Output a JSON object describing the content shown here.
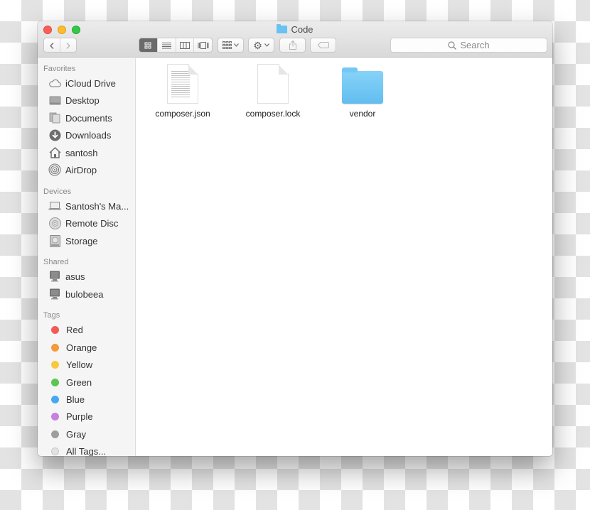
{
  "window": {
    "title": "Code",
    "title_icon": "folder-icon"
  },
  "toolbar": {
    "back_icon": "‹",
    "forward_icon": "›",
    "view_modes": [
      {
        "name": "icon-view",
        "glyph": "▦",
        "active": true
      },
      {
        "name": "list-view",
        "glyph": "≡",
        "active": false
      },
      {
        "name": "column-view",
        "glyph": "▥",
        "active": false
      },
      {
        "name": "cover-flow-view",
        "glyph": "◫",
        "active": false
      }
    ],
    "arrange_glyph": "▦",
    "action_glyph": "⚙",
    "chevron": "⌄",
    "share_glyph": "⇧",
    "tag_glyph": "⬭",
    "search_placeholder": "Search",
    "search_icon": "🔍"
  },
  "sidebar": {
    "sections": [
      {
        "title": "Favorites",
        "items": [
          {
            "label": "iCloud Drive",
            "icon": "cloud-icon"
          },
          {
            "label": "Desktop",
            "icon": "desktop-icon"
          },
          {
            "label": "Documents",
            "icon": "documents-icon"
          },
          {
            "label": "Downloads",
            "icon": "downloads-icon"
          },
          {
            "label": "santosh",
            "icon": "home-icon"
          },
          {
            "label": "AirDrop",
            "icon": "airdrop-icon"
          }
        ]
      },
      {
        "title": "Devices",
        "items": [
          {
            "label": "Santosh's Ma...",
            "icon": "laptop-icon"
          },
          {
            "label": "Remote Disc",
            "icon": "disc-icon"
          },
          {
            "label": "Storage",
            "icon": "drive-icon"
          }
        ]
      },
      {
        "title": "Shared",
        "items": [
          {
            "label": "asus",
            "icon": "computer-icon"
          },
          {
            "label": "bulobeea",
            "icon": "computer-icon"
          }
        ]
      },
      {
        "title": "Tags",
        "items": [
          {
            "label": "Red",
            "color": "#f25a55"
          },
          {
            "label": "Orange",
            "color": "#f6993b"
          },
          {
            "label": "Yellow",
            "color": "#f8c93e"
          },
          {
            "label": "Green",
            "color": "#5cc653"
          },
          {
            "label": "Blue",
            "color": "#46a8f2"
          },
          {
            "label": "Purple",
            "color": "#c77fe0"
          },
          {
            "label": "Gray",
            "color": "#9d9d9d"
          },
          {
            "label": "All Tags...",
            "color": "#e2e2e2"
          }
        ]
      }
    ]
  },
  "files": [
    {
      "name": "composer.json",
      "type": "text-document"
    },
    {
      "name": "composer.lock",
      "type": "blank-document"
    },
    {
      "name": "vendor",
      "type": "folder"
    }
  ]
}
